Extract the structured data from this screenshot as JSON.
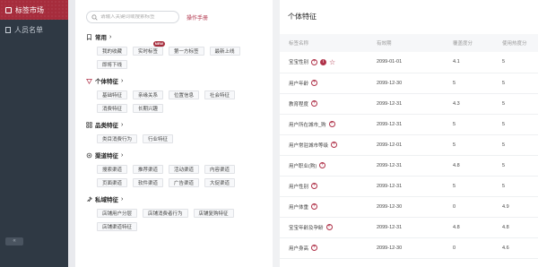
{
  "sidebar": {
    "items": [
      {
        "label": "标签市场",
        "icon": "tag-icon"
      },
      {
        "label": "人员名单",
        "icon": "doc-icon"
      }
    ],
    "collapse_label": "«"
  },
  "search": {
    "placeholder": "请输入关键词或搜索标签",
    "manual_label": "操作手册"
  },
  "groups": [
    {
      "name": "常用",
      "icon": "bookmark-icon",
      "tags": [
        "我的收藏",
        "实时标签",
        "第一方标签",
        "最新上线",
        "即将下线"
      ],
      "new_tag_index": 1
    },
    {
      "name": "个体特征",
      "icon": "person-icon",
      "tags": [
        "基础特征",
        "亲缘关系",
        "位置信息",
        "社会特征",
        "消费特征",
        "长期兴趣"
      ]
    },
    {
      "name": "品类特征",
      "icon": "grid-icon",
      "tags": [
        "类目消费行为",
        "行业特征"
      ]
    },
    {
      "name": "渠道特征",
      "icon": "channel-icon",
      "tags": [
        "搜索渠道",
        "推荐渠道",
        "活动渠道",
        "内容渠道",
        "页面渠道",
        "软件渠道",
        "广告渠道",
        "大促渠道"
      ]
    },
    {
      "name": "私域特征",
      "icon": "pin-icon",
      "tags": [
        "店铺用户分层",
        "店铺消费者行为",
        "店铺复购特征",
        "店铺渠道特征"
      ]
    }
  ],
  "new_badge": "NEW",
  "feature_panel": {
    "title": "个体特征",
    "columns": [
      "标签名称",
      "有效期",
      "覆盖度分",
      "使用热度分"
    ],
    "rows": [
      {
        "name": "宝宝性别",
        "date": "2099-01-01",
        "coverage": "4.1",
        "heat": "5",
        "extra": true
      },
      {
        "name": "用户年龄",
        "date": "2099-12-30",
        "coverage": "5",
        "heat": "5"
      },
      {
        "name": "教育程度",
        "date": "2099-12-31",
        "coverage": "4.3",
        "heat": "5"
      },
      {
        "name": "用户所在城市_购",
        "date": "2099-12-31",
        "coverage": "5",
        "heat": "5"
      },
      {
        "name": "用户常驻城市等级",
        "date": "2099-12-01",
        "coverage": "5",
        "heat": "5"
      },
      {
        "name": "用户职业(购)",
        "date": "2099-12-31",
        "coverage": "4.8",
        "heat": "5"
      },
      {
        "name": "用户性别",
        "date": "2099-12-31",
        "coverage": "5",
        "heat": "5"
      },
      {
        "name": "用户体重",
        "date": "2099-12-30",
        "coverage": "0",
        "heat": "4.9"
      },
      {
        "name": "宝宝年龄及孕龄",
        "date": "2099-12-31",
        "coverage": "4.8",
        "heat": "4.8"
      },
      {
        "name": "用户身高",
        "date": "2099-12-30",
        "coverage": "0",
        "heat": "4.6"
      }
    ]
  },
  "colors": {
    "accent": "#b0334a",
    "sidebar": "#2f3944",
    "active_nav": "#a62c3c"
  }
}
